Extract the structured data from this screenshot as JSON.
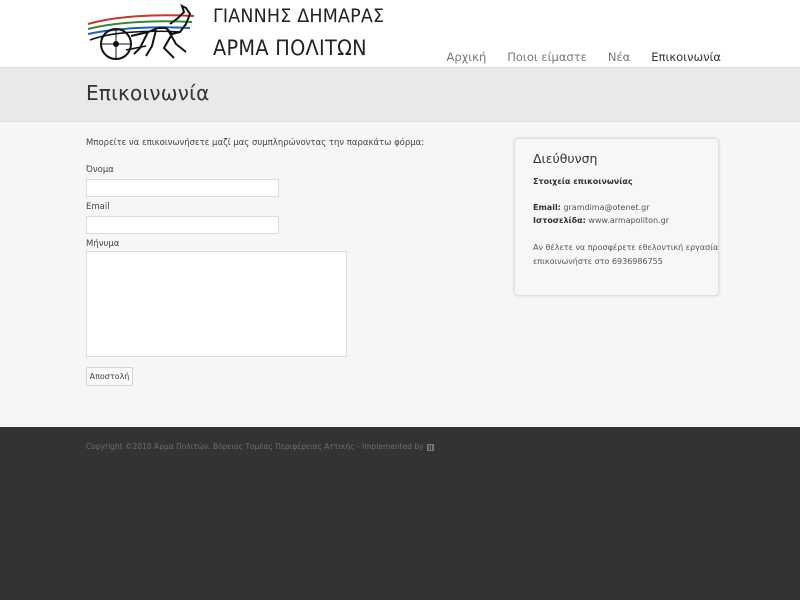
{
  "header": {
    "logo_line1": "ΓΙΑΝΝΗΣ ΔΗΜΑΡΑΣ",
    "logo_line2": "ΑΡΜΑ ΠΟΛΙΤΩΝ",
    "logo_icon": "horse-chariot-icon",
    "nav": [
      {
        "label": "Αρχική",
        "active": false
      },
      {
        "label": "Ποιοι είμαστε",
        "active": false
      },
      {
        "label": "Νέα",
        "active": false
      },
      {
        "label": "Επικοινωνία",
        "active": true
      }
    ]
  },
  "page": {
    "title": "Επικοινωνία"
  },
  "form": {
    "intro": "Μπορείτε να επικοινωνήσετε μαζί μας συμπληρώνοντας την παρακάτω φόρμα:",
    "name_label": "Όνομα",
    "name_value": "",
    "email_label": "Email",
    "email_value": "",
    "message_label": "Μήνυμα",
    "message_value": "",
    "submit_label": "Αποστολή"
  },
  "address": {
    "title": "Διεύθυνση",
    "subtitle": "Στοιχεία επικοινωνίας",
    "email_key": "Email:",
    "email_value": "gramdima@otenet.gr",
    "website_key": "Ιστοσελίδα:",
    "website_value": "www.armapoliton.gr",
    "volunteer_line1": "Αν θέλετε να προσφέρετε εθελοντική εργασία",
    "volunteer_line2": "επικοινωνήστε στο 6936986755"
  },
  "footer": {
    "copyright": "Copyright ©2010 Άρμα Πολιτών. Βόρειος Τομέας Περιφέρειας Αττικής - Implemented by",
    "implementer_icon": "implementer-logo-icon"
  },
  "colors": {
    "header_bg": "#ffffff",
    "title_bar_bg": "#e9e9e9",
    "content_bg": "#f6f6f6",
    "footer_bg": "#333333",
    "logo_red": "#c0392b",
    "logo_green": "#2e8b3a",
    "logo_blue": "#1f5fbf"
  }
}
